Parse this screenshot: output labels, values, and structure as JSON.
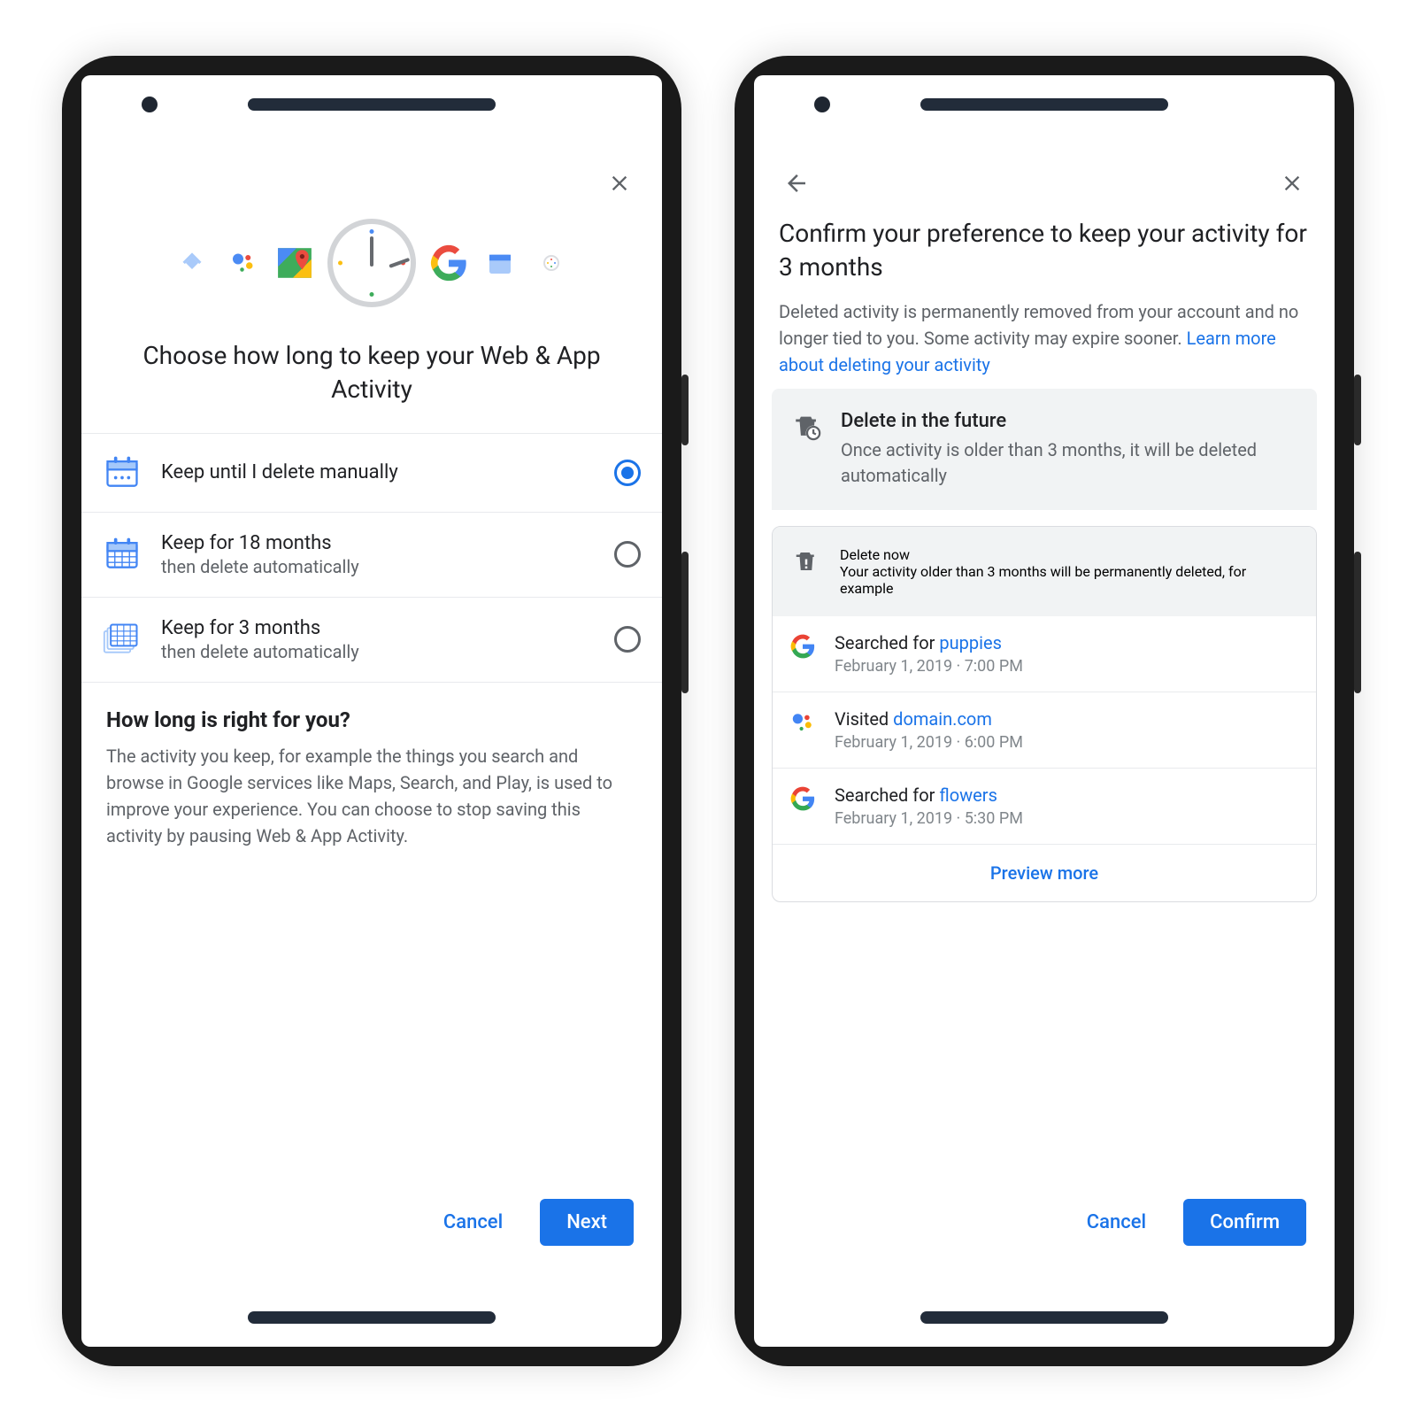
{
  "phone1": {
    "title": "Choose how long to keep your Web & App Activity",
    "options": [
      {
        "primary": "Keep until I delete manually",
        "secondary": "",
        "selected": true
      },
      {
        "primary": "Keep for 18 months",
        "secondary": "then delete automatically",
        "selected": false
      },
      {
        "primary": "Keep for 3 months",
        "secondary": "then delete automatically",
        "selected": false
      }
    ],
    "help_heading": "How long is right for you?",
    "help_body": "The activity you keep, for example the things you search and browse in Google services like Maps, Search, and Play, is used to improve your experience. You can choose to stop saving this activity by pausing Web & App Activity.",
    "cancel": "Cancel",
    "next": "Next"
  },
  "phone2": {
    "title": "Confirm your preference to keep your activity for 3 months",
    "subtitle_prefix": "Deleted activity is permanently removed from your account and no longer tied to you. Some activity may expire sooner. ",
    "subtitle_link": "Learn more about deleting your activity",
    "future": {
      "title": "Delete in the future",
      "desc": "Once activity is older than 3 months, it will be deleted automatically"
    },
    "now": {
      "title": "Delete now",
      "desc": "Your activity older than 3 months will be permanently deleted, for example"
    },
    "activities": [
      {
        "icon": "google",
        "prefix": "Searched for ",
        "keyword": "puppies",
        "meta": "February 1, 2019 · 7:00 PM"
      },
      {
        "icon": "assistant",
        "prefix": "Visited ",
        "keyword": "domain.com",
        "meta": "February 1, 2019 · 6:00 PM"
      },
      {
        "icon": "google",
        "prefix": "Searched for ",
        "keyword": "flowers",
        "meta": "February 1, 2019 · 5:30 PM"
      }
    ],
    "preview_more": "Preview more",
    "cancel": "Cancel",
    "confirm": "Confirm"
  }
}
